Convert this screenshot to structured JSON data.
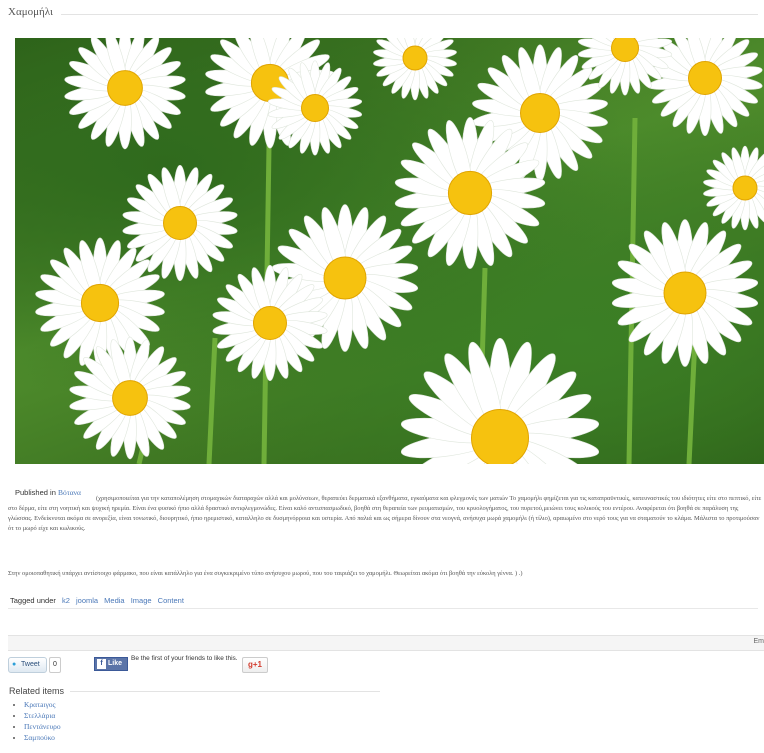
{
  "article": {
    "title": "Χαμομήλι",
    "published_label": "Published in",
    "category": "Βότανα",
    "paragraph1": "(χρησιμοποιείται για την καταπολέμηση στομαχικών διαταραχών αλλά και μολύνσεων, θεραπεύει δερματικά εξανθήματα, εγκαύματα και φλεγμονές των ματιών Το χαμομήλι φημίζεται για τις καταπραϋντικές, κατευναστικές του ιδιότητες είτε στο πεπτικό, είτε στο δέρμα, είτε στη νοητική και ψυχική ηρεμία. Είναι ένα φυσικό ήπιο αλλά δραστικό αντιφλεγμονώδες. Είναι καλό αντισπασμωδικό, βοηθά στη θεραπεία των ρευματισμών, του κρυολογήματος, του πυρετού,μειώνει τους κολικούς του εντέρου. Αναφέρεται ότι βοηθά σε παράλυση της γλώσσας. Ενδείκνυται ακόμα σε ανορεξία, είναι τονωτικό, διουρητικό, ήπιο ηρεμιστικό, καταλληλο σε δυσμηνόρροια και υστερία. Από παλιά και ως σήμερα δίνουν στα νεογνά, ανήσυχα μωρά χαμομήλι (ή τίλιο), αραιωμένο στο νερό τους για να σταματούν το κλάμα. Μάλιστα το προτιμούσαν ότ το μωρό είχε και κωλικούς.",
    "paragraph2": "Στην ομοιοπαθητική υπάρχει αντίστοιχο φάρμακο, που είναι κατάλληλο για ένα συγκεκριμένο τύπο ανήσυχου μωρού, που του ταιριάζει το χαμομήλι. Θεωρείται ακόμα ότι βοηθά την εύκολη γέννα. ) .)",
    "tags_label": "Tagged under",
    "tags": [
      "k2",
      "joomla",
      "Media",
      "Image",
      "Content"
    ],
    "bar_text": "Em"
  },
  "social": {
    "tweet_label": "Tweet",
    "tweet_count": "0",
    "fb_label": "Like",
    "fb_text": "Be the first of your friends to like this.",
    "gplus_label": "g+1"
  },
  "related": {
    "title": "Related items",
    "items": [
      "Κρατaιγος",
      "Στελλάρια",
      "Πεντάνευρο",
      "Σαμπούκο"
    ]
  },
  "colors": {
    "link": "#4a78b8",
    "petal": "#ffffff",
    "center": "#f6c20f",
    "foliage": "#3b7f25"
  }
}
